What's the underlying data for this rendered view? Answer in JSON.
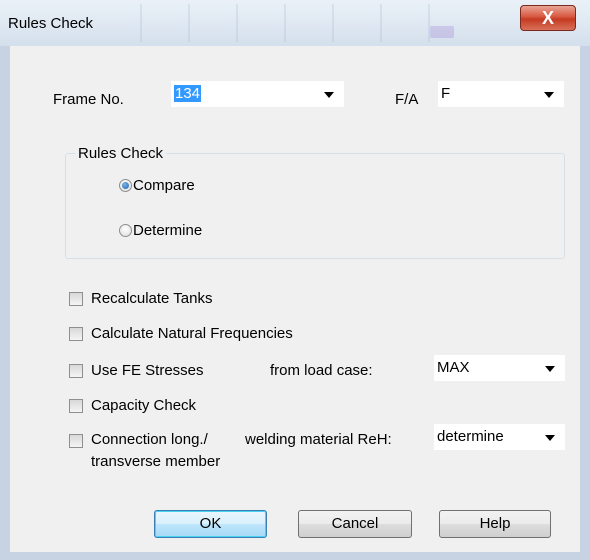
{
  "window": {
    "title": "Rules Check",
    "close_glyph": "X"
  },
  "frame": {
    "label": "Frame No.",
    "value": "134"
  },
  "fa": {
    "label": "F/A",
    "value": "F"
  },
  "rules_group": {
    "title": "Rules Check",
    "options": [
      {
        "label": "Compare",
        "selected": true
      },
      {
        "label": "Determine",
        "selected": false
      }
    ]
  },
  "checks": {
    "recalc": {
      "label": "Recalculate Tanks",
      "checked": false
    },
    "natural": {
      "label": "Calculate Natural Frequencies",
      "checked": false
    },
    "fe": {
      "label": "Use FE Stresses",
      "checked": false
    },
    "capacity": {
      "label": "Capacity Check",
      "checked": false
    },
    "connection": {
      "label_line1": "Connection long./",
      "label_line2": "transverse member",
      "checked": false
    }
  },
  "load_case": {
    "label": "from load case:",
    "value": "MAX"
  },
  "welding": {
    "label": "welding material ReH:",
    "value": "determine"
  },
  "buttons": {
    "ok": "OK",
    "cancel": "Cancel",
    "help": "Help"
  },
  "colors": {
    "selection": "#3399ff",
    "close_button": "#c53a22",
    "dialog_bg": "#f0f0f0"
  }
}
